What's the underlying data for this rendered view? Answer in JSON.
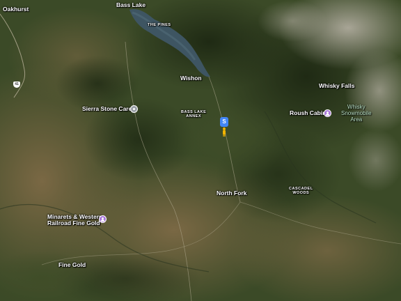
{
  "colors": {
    "forest_dark": "#243118",
    "forest_mid": "#3b4a27",
    "dry_land": "#6a5a38",
    "granite": "#9a978a",
    "lake": "#3e5562",
    "label_text": "#ffffff",
    "area_text": "#b9e0c4",
    "purple_pin": "#a977d9",
    "gray_pin": "#9aa0a6",
    "street_view_blue": "#4285f4",
    "peg_yellow": "#f2b400"
  },
  "places": {
    "oakhurst": "Oakhurst",
    "bass_lake": "Bass Lake",
    "the_pines": "THE PINES",
    "wishon": "Wishon",
    "sierra_stone_care": "Sierra Stone Care",
    "bass_lake_annex_1": "BASS LAKE",
    "bass_lake_annex_2": "ANNEX",
    "whisky_falls": "Whisky Falls",
    "roush_cabin": "Roush Cabin",
    "whisky_area_1": "Whisky",
    "whisky_area_2": "Snowmobile",
    "whisky_area_3": "Area",
    "north_fork": "North Fork",
    "cascadel_1": "CASCADEL",
    "cascadel_2": "WOODS",
    "minarets_1": "Minarets & Western",
    "minarets_2": "Railroad Fine Gold",
    "fine_gold": "Fine Gold",
    "highway": "41"
  },
  "icons": {
    "poi_pin": "place-pin-icon",
    "business_pin": "business-pin-icon",
    "street_view": "street-view-marker-icon",
    "pegman": "pegman-icon"
  },
  "street_view_marker_text": "S"
}
